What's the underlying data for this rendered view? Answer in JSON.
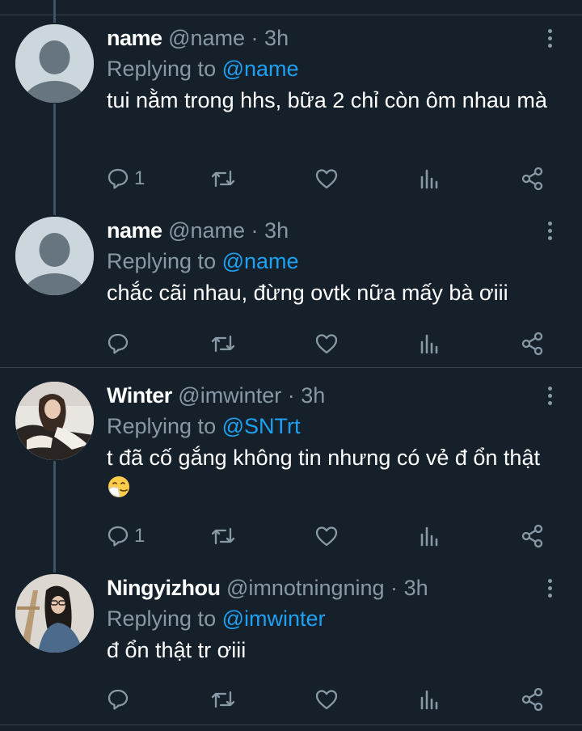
{
  "colors": {
    "background": "#15202b",
    "secondary_text": "#8899a6",
    "mention": "#1da1f2",
    "divider": "#38444d",
    "thread_line": "#3d5466"
  },
  "tweets": [
    {
      "display_name": "name",
      "handle": "@name",
      "dot": "·",
      "time": "3h",
      "replying_prefix": "Replying to ",
      "replying_to": "@name",
      "text": "tui nằm trong hhs, bữa 2 chỉ còn ôm nhau mà",
      "reply_count": "1",
      "avatar": "default-avatar"
    },
    {
      "display_name": "name",
      "handle": "@name",
      "dot": "·",
      "time": "3h",
      "replying_prefix": "Replying to ",
      "replying_to": "@name",
      "text": "chắc cãi nhau, đừng ovtk nữa mấy bà ơiii",
      "reply_count": "",
      "avatar": "default-avatar"
    },
    {
      "display_name": "Winter",
      "handle": "@imwinter",
      "dot": "·",
      "time": "3h",
      "replying_prefix": "Replying to ",
      "replying_to": "@SNTrt",
      "text": "t đã cố gắng không tin nhưng có vẻ đ ổn thật",
      "text_emoji": "sneezing-face-emoji",
      "reply_count": "1",
      "avatar": "photo-avatar"
    },
    {
      "display_name": "Ningyizhou",
      "handle": "@imnotningning",
      "dot": "·",
      "time": "3h",
      "replying_prefix": "Replying to ",
      "replying_to": "@imwinter",
      "text": "đ ổn thật tr ơiii",
      "reply_count": "",
      "avatar": "photo-avatar"
    }
  ],
  "icons": {
    "reply": "reply-icon",
    "retweet": "retweet-icon",
    "like": "heart-icon",
    "analytics": "analytics-icon",
    "share": "share-icon",
    "more": "more-vertical-icon"
  }
}
